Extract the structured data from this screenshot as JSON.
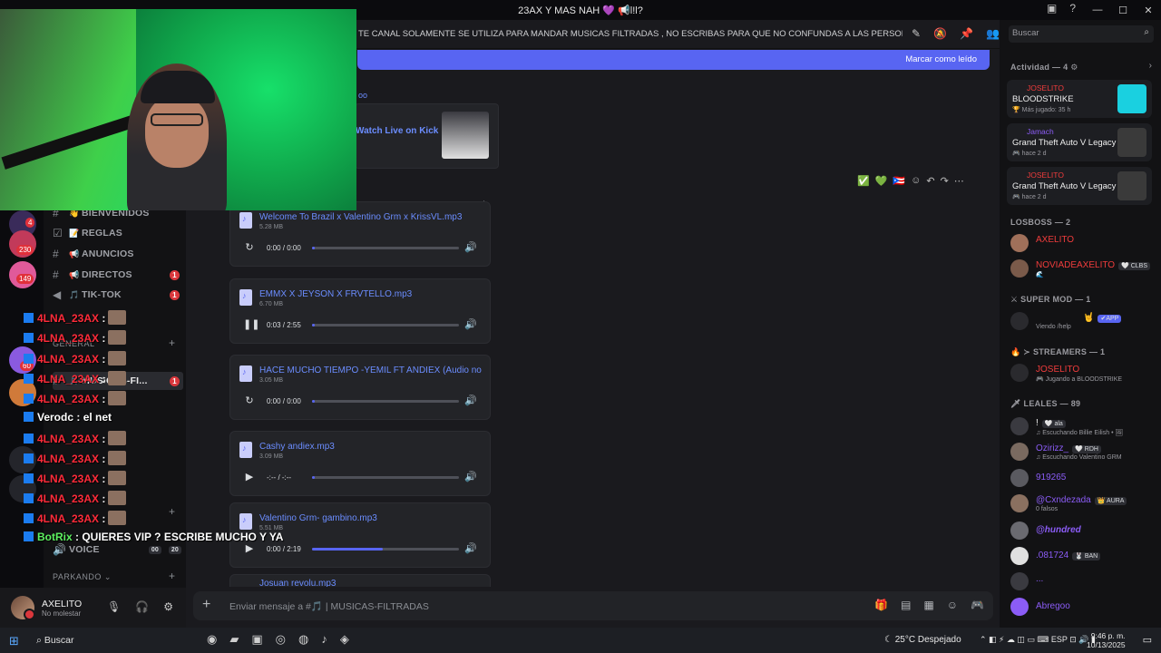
{
  "window": {
    "title": "23AX Y MAS NAH 💜 📢l!l?",
    "controls": [
      "—",
      "☐",
      "✕"
    ]
  },
  "header": {
    "topic": "TE CANAL SOLAMENTE SE UTILIZA PARA MANDAR MUSICAS FILTRADAS , NO ESCRIBAS PARA QUE NO CONFUNDAS A LAS PERSONAS QUE B...",
    "search_placeholder": "Buscar"
  },
  "unread_bar": {
    "mark_read": "Marcar como leído"
  },
  "server_badges": [
    "4",
    "230",
    "149",
    "60"
  ],
  "channels": [
    {
      "emoji": "👋",
      "label": "BIENVENIDOS",
      "unread": ""
    },
    {
      "emoji": "📝",
      "label": "REGLAS",
      "unread": ""
    },
    {
      "emoji": "📢",
      "label": "ANUNCIOS",
      "unread": ""
    },
    {
      "emoji": "📢",
      "label": "DIRECTOS",
      "unread": "1"
    },
    {
      "emoji": "🎵",
      "label": "TIK-TOK",
      "unread": "1"
    },
    {
      "emoji": "🎵",
      "label": "MUSICAS-FI...",
      "unread": "1"
    },
    {
      "emoji": "🔊",
      "label": "VOICE",
      "unread": ""
    }
  ],
  "categories": {
    "general": "GENERAL",
    "parkando": "PARKANDO ⌄"
  },
  "voice_counts": [
    "00",
    "20"
  ],
  "user": {
    "name": "AXELITO",
    "status": "No molestar"
  },
  "embed": {
    "title": "Watch Live on Kick",
    "link_tail": "oo"
  },
  "audio_files": [
    {
      "name": "Welcome To Brazil x Valentino Grm x KrissVL.mp3",
      "size": "5.28 MB",
      "time": "0:00 / 0:00",
      "progress": 0.0,
      "control": "↻"
    },
    {
      "name": "EMMX X JEYSON X FRVTELLO.mp3",
      "size": "6.70 MB",
      "time": "0:03 / 2:55",
      "progress": 0.02,
      "control": "❚❚"
    },
    {
      "name": "HACE MUCHO TIEMPO -YEMIL FT ANDIEX (Audio no c",
      "size": "3.05 MB",
      "time": "0:00 / 0:00",
      "progress": 0.0,
      "control": "↻"
    },
    {
      "name": "Cashy andiex.mp3",
      "size": "3.09 MB",
      "time": "-:-- / -:--",
      "progress": 0.0,
      "control": "▶"
    },
    {
      "name": "Valentino Grm- gambino.mp3",
      "size": "5.51 MB",
      "time": "0:00 / 2:19",
      "progress": 0.48,
      "control": "▶"
    }
  ],
  "next_file": "Josuan revolu.mp3",
  "composer": {
    "placeholder": "Enviar mensaje a #🎵 | MUSICAS-FILTRADAS"
  },
  "members": {
    "activity_header": "Actividad — 4 ⚙",
    "activities": [
      {
        "who": "JOSELITO",
        "game": "BLOODSTRIKE",
        "meta": "🏆 Más jugado: 35 h",
        "color": "#f03c3c"
      },
      {
        "who": "Jamach",
        "game": "Grand Theft Auto V Legacy",
        "meta": "🎮 hace 2 d",
        "color": "#8b5cf6"
      },
      {
        "who": "JOSELITO",
        "game": "Grand Theft Auto V Legacy",
        "meta": "🎮 hace 2 d",
        "color": "#f03c3c"
      }
    ],
    "losboss_header": "LOSBOSS — 2",
    "losboss": [
      {
        "name": "AXELITO",
        "sub": "",
        "tag": "",
        "color": "#f03c3c"
      },
      {
        "name": "NOVIADEAXELITO",
        "sub": "🌊",
        "tag": "🤍 CLBS",
        "color": "#f03c3c"
      }
    ],
    "supermod_header": "⚔ SUPER MOD — 1",
    "supermod": [
      {
        "name": "🤘",
        "sub": "Viendo /help",
        "tag": "✔APP",
        "color": "#f0f0f0"
      }
    ],
    "streamers_header": "🔥 ≻ STREAMERS — 1",
    "streamers": [
      {
        "name": "JOSELITO",
        "sub": "🎮 Jugando a BLOODSTRIKE",
        "tag": "",
        "color": "#f03c3c"
      }
    ],
    "leales_header": "🗡 LEALES — 89",
    "leales": [
      {
        "name": "!",
        "sub": "♫ Escuchando Billie Eilish • 🖼",
        "tag": "🤍 ala",
        "color": "#f0f0f0"
      },
      {
        "name": "Ozirizz_",
        "sub": "♫ Escuchando Valentino GRM",
        "tag": "🤍 RDH",
        "color": "#8b5cf6"
      },
      {
        "name": "919265",
        "sub": "",
        "tag": "",
        "color": "#8b5cf6"
      },
      {
        "name": "@Cxndezada",
        "sub": "0 falsos",
        "tag": "👑 AURA",
        "color": "#8b5cf6"
      },
      {
        "name": "@hundred",
        "sub": "",
        "tag": "",
        "color": "#8b5cf6"
      },
      {
        "name": ".081724",
        "sub": "",
        "tag": "🐰 BAN",
        "color": "#8b5cf6"
      },
      {
        "name": "...",
        "sub": "",
        "tag": "",
        "color": "#8b5cf6"
      },
      {
        "name": "Abregoo",
        "sub": "",
        "tag": "",
        "color": "#8b5cf6"
      }
    ]
  },
  "chat_overlay": [
    {
      "user": "4LNA_23AX",
      "msg": ":",
      "color": "#ff2b3a",
      "emote": true
    },
    {
      "user": "4LNA_23AX",
      "msg": ":",
      "color": "#ff2b3a",
      "emote": true
    },
    {
      "user": "4LNA_23AX",
      "msg": ":",
      "color": "#ff2b3a",
      "emote": true
    },
    {
      "user": "4LNA_23AX",
      "msg": ":",
      "color": "#ff2b3a",
      "emote": true
    },
    {
      "user": "4LNA_23AX",
      "msg": ":",
      "color": "#ff2b3a",
      "emote": true
    },
    {
      "user": "Verodc",
      "msg": ": el net",
      "color": "#ffffff",
      "emote": false
    },
    {
      "user": "4LNA_23AX",
      "msg": ":",
      "color": "#ff2b3a",
      "emote": true
    },
    {
      "user": "4LNA_23AX",
      "msg": ":",
      "color": "#ff2b3a",
      "emote": true
    },
    {
      "user": "4LNA_23AX",
      "msg": ":",
      "color": "#ff2b3a",
      "emote": true
    },
    {
      "user": "4LNA_23AX",
      "msg": ":",
      "color": "#ff2b3a",
      "emote": true
    },
    {
      "user": "4LNA_23AX",
      "msg": ":",
      "color": "#ff2b3a",
      "emote": true
    },
    {
      "user": "BotRix",
      "msg": ": QUIERES VIP ? ESCRIBE MUCHO Y YA",
      "color": "#5df060",
      "emote": false
    }
  ],
  "taskbar": {
    "search": "Buscar",
    "weather": "25°C  Despejado",
    "lang": "ESP",
    "time": "9:46 p. m.",
    "date": "10/13/2025"
  },
  "colors": {
    "accent": "#5865f2",
    "danger": "#da373c",
    "link": "#6b8dff"
  }
}
